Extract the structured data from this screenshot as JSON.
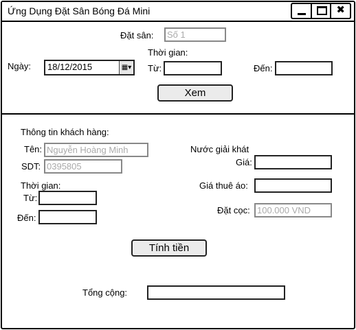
{
  "window": {
    "title": "Ứng Dụng Đặt Sân Bóng Đá Mini",
    "controls": {
      "minimize_icon": "minimize-icon",
      "maximize_icon": "maximize-icon",
      "close_glyph": "✖"
    }
  },
  "booking": {
    "field_label": "Đặt sân:",
    "field_value": "Số 1",
    "date_label": "Ngày:",
    "date_value": "18/12/2015",
    "calendar_glyph": "▦▾",
    "time_heading": "Thời gian:",
    "from_label": "Từ:",
    "from_value": "",
    "to_label": "Đến:",
    "to_value": "",
    "view_button": "Xem"
  },
  "customer": {
    "heading": "Thông tin khách hàng:",
    "name_label": "Tên:",
    "name_value": "Nguyễn Hoàng Minh",
    "phone_label": "SDT:",
    "phone_value": "0395805",
    "time_heading": "Thời gian:",
    "from_label": "Từ:",
    "from_value": "",
    "to_label": "Đến:",
    "to_value": ""
  },
  "pricing": {
    "drinks_heading": "Nước giải khát",
    "price_label": "Giá:",
    "price_value": "",
    "shirt_rent_label": "Giá thuê áo:",
    "shirt_rent_value": "",
    "deposit_label": "Đặt cọc:",
    "deposit_value": "100.000 VND",
    "calculate_button": "Tính tiền",
    "total_label": "Tổng cộng:",
    "total_value": ""
  }
}
